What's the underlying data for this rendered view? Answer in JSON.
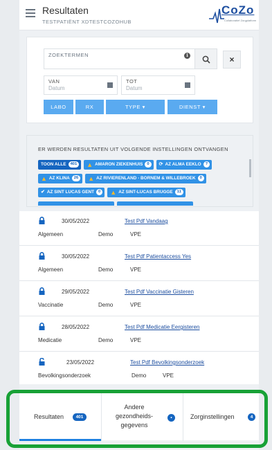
{
  "header": {
    "title": "Resultaten",
    "patient": "TESTPATIËNT XDTESTCOZOHUB",
    "logo_text": "CoZo",
    "logo_sub": "Collaboratief Zorgplatform",
    "menu_icon": "hamburger-icon"
  },
  "search": {
    "keywords_label": "ZOEKTERMEN",
    "info_icon": "info-icon",
    "search_icon": "magnifier-icon",
    "clear_label": "×",
    "from_label": "VAN",
    "from_placeholder": "Datum",
    "to_label": "TOT",
    "to_placeholder": "Datum",
    "buttons": [
      {
        "label": "LABO"
      },
      {
        "label": "RX"
      },
      {
        "label": "TYPE ▾"
      },
      {
        "label": "DIENST ▾"
      }
    ]
  },
  "institutions": {
    "header": "ER WERDEN RESULTATEN UIT VOLGENDE INSTELLINGEN ONTVANGEN",
    "chips": [
      {
        "label": "TOON ALLE",
        "count": "401",
        "status": "none"
      },
      {
        "label": "AMARON ZIEKENHUIS",
        "count": "0",
        "status": "warning"
      },
      {
        "label": "AZ ALMA EEKLO",
        "count": "?",
        "status": "loading"
      },
      {
        "label": "AZ KLINA",
        "count": "26",
        "status": "warning"
      },
      {
        "label": "AZ RIVIERENLAND - BORNEM & WILLEBROEK",
        "count": "0",
        "status": "warning"
      },
      {
        "label": "AZ SINT LUCAS GENT",
        "count": "0",
        "status": "ok"
      },
      {
        "label": "AZ SINT-LUCAS BRUGGE",
        "count": "11",
        "status": "warning"
      }
    ]
  },
  "results": [
    {
      "date": "30/05/2022",
      "title": "Test Pdf Vandaag",
      "category": "Algemeen",
      "source": "Demo",
      "type": "VPE",
      "locked": true
    },
    {
      "date": "30/05/2022",
      "title": "Test Pdf Patientaccess Yes",
      "category": "Algemeen",
      "source": "Demo",
      "type": "VPE",
      "locked": true
    },
    {
      "date": "29/05/2022",
      "title": "Test Pdf Vaccinatie Gisteren",
      "category": "Vaccinatie",
      "source": "Demo",
      "type": "VPE",
      "locked": true
    },
    {
      "date": "28/05/2022",
      "title": "Test Pdf Medicatie Eergisteren",
      "category": "Medicatie",
      "source": "Demo",
      "type": "VPE",
      "locked": true
    },
    {
      "date": "23/05/2022",
      "title": "Test Pdf Bevolkingsonderzoek",
      "category": "Bevolkingsonderzoek",
      "source": "Demo",
      "type": "VPE",
      "locked": false
    }
  ],
  "tabs": [
    {
      "label": "Resultaten",
      "badge": "401",
      "active": true
    },
    {
      "label": "Andere gezondheids-gegevens",
      "line1": "Andere",
      "line2": "gezondheids-",
      "line3": "gegevens",
      "badge": "•",
      "active": false
    },
    {
      "label": "Zorginstellingen",
      "badge": "4",
      "active": false
    }
  ],
  "colors": {
    "primary": "#1565c0",
    "button": "#5aaaf0",
    "chip": "#3192e6",
    "warning": "#f5b82e",
    "highlight": "#18a136",
    "link": "#1e4fa0"
  }
}
